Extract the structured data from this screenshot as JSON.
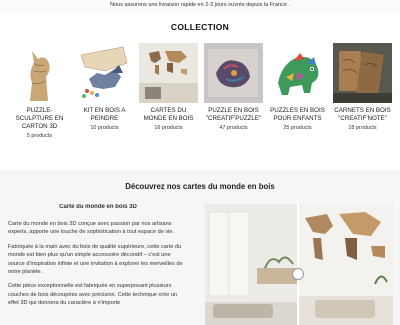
{
  "announcement": "Nous assurons une livraison rapide en 2-3 jours ouvrés depuis la France .",
  "collection": {
    "title": "COLLECTION",
    "items": [
      {
        "name": "PUZZLE-SCULPTURE EN CARTON 3D",
        "count": "5 products"
      },
      {
        "name": "KIT EN BOIS A PEINDRE",
        "count": "10 products"
      },
      {
        "name": "CARTES DU MONDE EN BOIS",
        "count": "16 products"
      },
      {
        "name": "PUZZLE EN BOIS \"CREATIF'PUZZLE\"",
        "count": "47 products"
      },
      {
        "name": "PUZZLES EN BOIS POUR ENFANTS",
        "count": "25 products"
      },
      {
        "name": "CARNETS EN BOIS \"CREATIF'NOTE\"",
        "count": "18 products"
      }
    ]
  },
  "feature": {
    "title": "Découvrez nos cartes du monde en bois",
    "subtitle": "Carte du monde en bois 3D",
    "paragraphs": [
      "Carte du monde en bois 3D conçue avec passion par nos artisans experts, apporte une touche de sophistication à tout espace de vie.",
      "Fabriquée à la main avec du bois de qualité supérieure, cette carte du monde est bien plus qu'un simple accessoire décoratif – c'est une source d'inspiration infinie et une invitation à explorer les merveilles de notre planète.",
      "Cette pièce exceptionnelle est fabriquée en superposant plusieurs couches de bois découpées avec précision. Cette technique crée un effet 3D qui donnera du caractère à n'importe"
    ]
  }
}
